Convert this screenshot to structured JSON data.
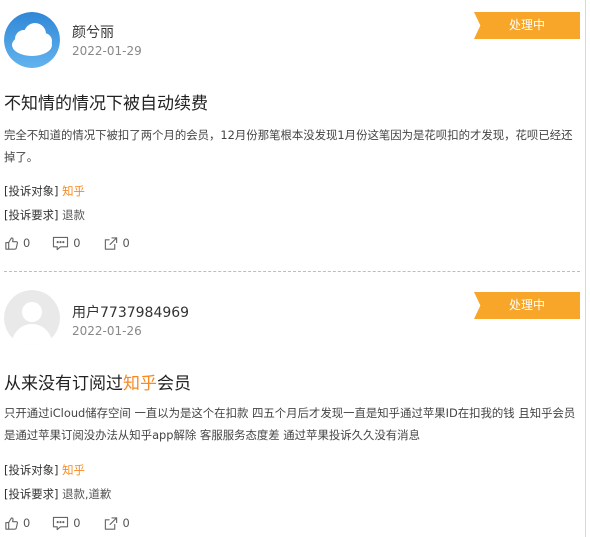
{
  "colors": {
    "badge": "#f7a629",
    "highlight": "#f7891e"
  },
  "posts": [
    {
      "user": "颜兮丽",
      "date": "2022-01-29",
      "status": "处理中",
      "title": "不知情的情况下被自动续费",
      "body": "完全不知道的情况下被扣了两个月的会员，12月份那笔根本没发现1月份这笔因为是花呗扣的才发现，花呗已经还掉了。",
      "target_label": "[投诉对象]",
      "target_value": "知乎",
      "request_label": "[投诉要求]",
      "request_value": "退款",
      "likes": "0",
      "comments": "0",
      "shares": "0",
      "avatar_icon": "cloud-avatar"
    },
    {
      "user": "用户7737984969",
      "date": "2022-01-26",
      "status": "处理中",
      "title_pre": "从来没有订阅过",
      "title_hl": "知乎",
      "title_post": "会员",
      "body": "只开通过iCloud储存空间 一直以为是这个在扣款 四五个月后才发现一直是知乎通过苹果ID在扣我的钱 且知乎会员是通过苹果订阅没办法从知乎app解除 客服服务态度差 通过苹果投诉久久没有消息",
      "target_label": "[投诉对象]",
      "target_value": "知乎",
      "request_label": "[投诉要求]",
      "request_value": "退款,道歉",
      "likes": "0",
      "comments": "0",
      "shares": "0",
      "avatar_icon": "default-avatar"
    }
  ]
}
